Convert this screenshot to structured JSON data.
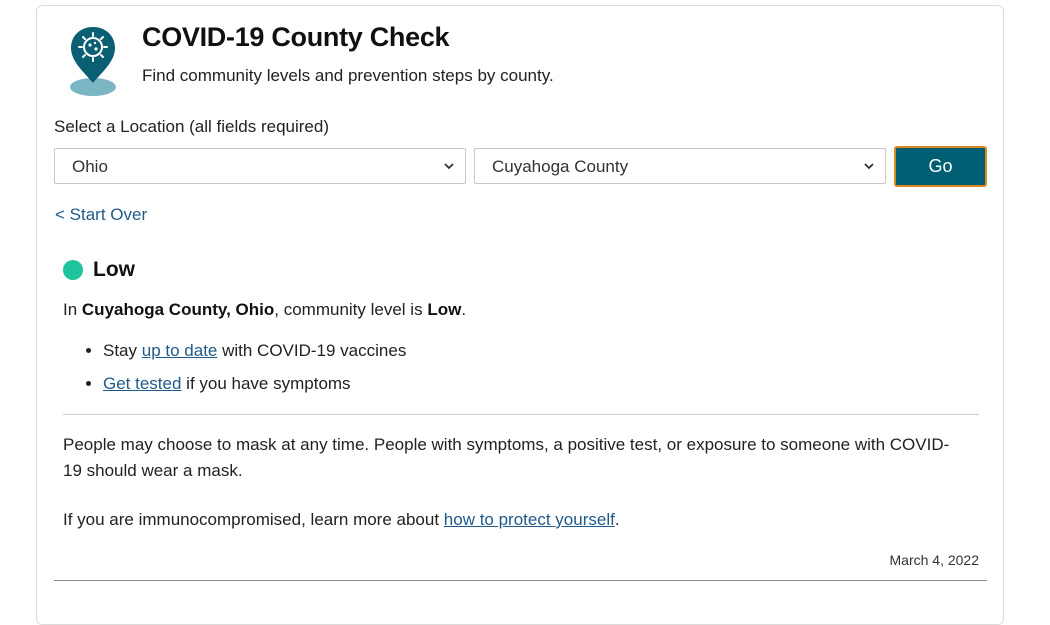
{
  "header": {
    "title": "COVID-19 County Check",
    "subtitle": "Find community levels and prevention steps by county.",
    "logo_icon": "map-pin-virus-icon"
  },
  "form": {
    "label": "Select a Location (all fields required)",
    "state_value": "Ohio",
    "county_value": "Cuyahoga County",
    "go_label": "Go",
    "start_over": "< Start Over"
  },
  "result": {
    "level": "Low",
    "level_color": "#1fc39c",
    "sentence_prefix": "In ",
    "sentence_location": "Cuyahoga County, Ohio",
    "sentence_middle": ", community level is ",
    "sentence_level": "Low",
    "sentence_end": ".",
    "bullets": [
      {
        "before": "Stay ",
        "link": "up to date",
        "after": " with COVID-19 vaccines"
      },
      {
        "before": "",
        "link": "Get tested",
        "after": " if you have symptoms"
      }
    ],
    "mask_text": "People may choose to mask at any time. People with symptoms, a positive test, or exposure to someone with COVID-19 should wear a mask.",
    "immuno_prefix": "If you are immunocompromised, learn more about ",
    "immuno_link": "how to protect yourself",
    "immuno_suffix": ".",
    "date": "March 4, 2022"
  },
  "colors": {
    "brand_teal": "#005e73",
    "button_border": "#d98a23",
    "link": "#1f5a8a"
  }
}
